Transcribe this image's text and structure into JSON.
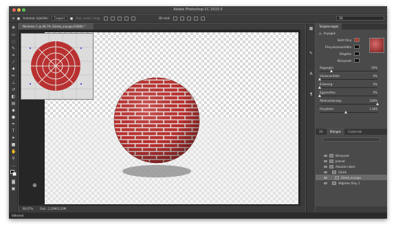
{
  "window": {
    "title": "Adobe Photoshop CC 2015.5"
  },
  "options_bar": {
    "auto_select_label": "Automat. kijelölés:",
    "auto_select_value": "Csoport",
    "transform_label": "Átal. vezérl. megj.",
    "mode_label": "3D mód:",
    "workspace_value": "3D"
  },
  "document": {
    "tab_label": "Névtelen-1 @ 66,7% (Gömb_anyaga,RGB/8) *"
  },
  "status": {
    "zoom": "66,67%",
    "doc_size": "Dok.: 2,20M/2,20M"
  },
  "bottom_bar": {
    "label": "Idővonal"
  },
  "properties": {
    "tab_label": "Tulajdonságok",
    "section_label": "Anyagok",
    "diffuse": {
      "label": "Szórt fény:",
      "color": "#b23a2f"
    },
    "specular": {
      "label": "Fényvisszaverődés:",
      "color": "#111111"
    },
    "illumination": {
      "label": "Világítás:",
      "color": "#111111"
    },
    "ambient": {
      "label": "Környezet:",
      "color": "#111111"
    },
    "sliders": [
      {
        "label": "Ragyogás:",
        "value": "20%",
        "level": 0.2
      },
      {
        "label": "Visszaverődés:",
        "value": "0%",
        "level": 0
      },
      {
        "label": "Érdesség:",
        "value": "0%",
        "level": 0
      },
      {
        "label": "Egyenetlen:",
        "value": "0%",
        "level": 0.0
      },
      {
        "label": "Átlátszatlanság:",
        "value": "100%",
        "level": 1
      },
      {
        "label": "Fénytörés:",
        "value": "1.000",
        "level": 0.45
      }
    ]
  },
  "layers": {
    "tabs": [
      "3D",
      "Rétegek",
      "Csatornák"
    ],
    "items": [
      {
        "label": "Környezet",
        "selected": false
      },
      {
        "label": "Jelenet",
        "selected": false
      },
      {
        "label": "Aktuális nézet",
        "selected": false
      },
      {
        "label": "Gömb",
        "selected": false
      },
      {
        "label": "Gömb_anyaga",
        "selected": true
      },
      {
        "label": "Végtelen fény 1",
        "selected": false
      }
    ]
  },
  "colors": {
    "brick": "#bf2f2f",
    "mortar": "#e8e4e0"
  }
}
